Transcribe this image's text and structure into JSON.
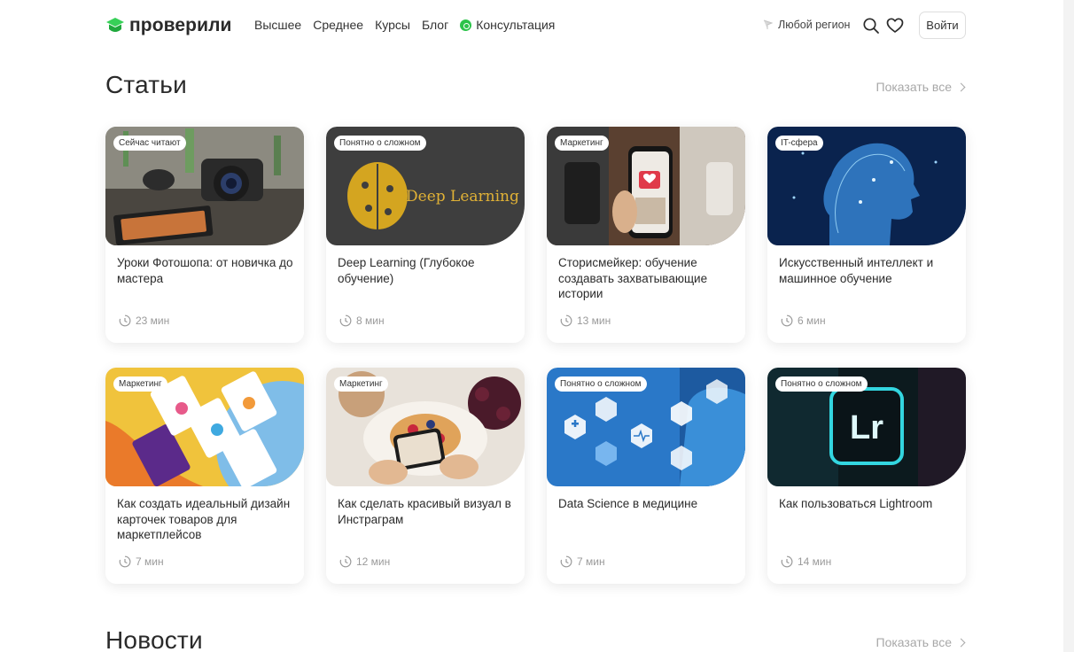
{
  "header": {
    "logo_text": "проверили",
    "nav": [
      "Высшее",
      "Среднее",
      "Курсы",
      "Блог"
    ],
    "consult_label": "Консультация",
    "region_label": "Любой регион",
    "login_label": "Войти"
  },
  "articles": {
    "title": "Статьи",
    "show_all": "Показать все",
    "cards": [
      {
        "badge": "Сейчас читают",
        "title": "Уроки Фотошопа: от новичка до мастера",
        "time": "23 мин"
      },
      {
        "badge": "Понятно о сложном",
        "title": "Deep Learning (Глубокое обучение)",
        "time": "8 мин",
        "image_text": "Deep Learning"
      },
      {
        "badge": "Маркетинг",
        "title": "Сторисмейкер: обучение создавать захватывающие истории",
        "time": "13 мин"
      },
      {
        "badge": "IT-сфера",
        "title": "Искусственный интеллект и машинное обучение",
        "time": "6 мин"
      },
      {
        "badge": "Маркетинг",
        "title": "Как создать идеальный дизайн карточек товаров для маркетплейсов",
        "time": "7 мин"
      },
      {
        "badge": "Маркетинг",
        "title": "Как сделать красивый визуал в Инстраграм",
        "time": "12 мин"
      },
      {
        "badge": "Понятно о сложном",
        "title": "Data Science в медицине",
        "time": "7 мин"
      },
      {
        "badge": "Понятно о сложном",
        "title": "Как пользоваться Lightroom",
        "time": "14 мин",
        "image_text": "Lr"
      }
    ]
  },
  "news": {
    "title": "Новости",
    "show_all": "Показать все"
  },
  "colors": {
    "brand_green": "#2cc34a",
    "muted": "#a8a8a8"
  }
}
